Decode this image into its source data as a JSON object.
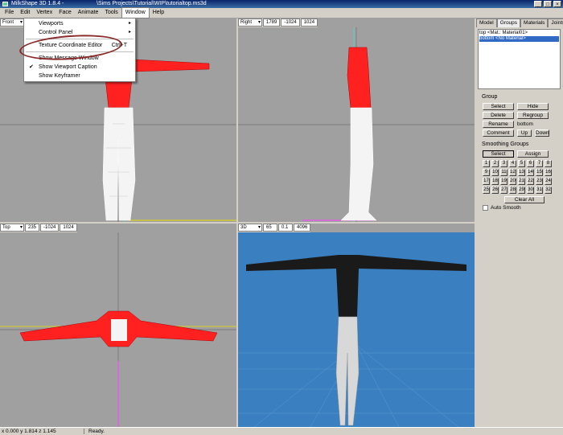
{
  "window": {
    "title": "MilkShape 3D 1.8.4 -",
    "path": "\\Sims Projects\\Tutorial\\WIP\\tutorialtop.ms3d"
  },
  "menu": [
    "File",
    "Edit",
    "Vertex",
    "Face",
    "Animate",
    "Tools",
    "Window",
    "Help"
  ],
  "dropdown": {
    "viewports": "Viewports",
    "control_panel": "Control Panel",
    "texture_editor": "Texture Coordinate Editor",
    "texture_shortcut": "Ctrl+T",
    "message_window": "Show Message Window",
    "viewport_caption": "Show Viewport Caption",
    "keyframer": "Show Keyframer",
    "check": "✔",
    "arrow": "▸"
  },
  "viewports": {
    "front": {
      "mode": "Front"
    },
    "right": {
      "mode": "Right",
      "v1": "1789",
      "v2": "-1024",
      "v3": "1024"
    },
    "top": {
      "mode": "Top",
      "v1": "235",
      "v2": "-1024",
      "v3": "1024"
    },
    "persp": {
      "mode": "3D",
      "v1": "65",
      "v2": "0.1",
      "v3": "4096"
    }
  },
  "panel": {
    "tabs": [
      "Model",
      "Groups",
      "Materials",
      "Joints"
    ],
    "groups": [
      "top <Mat.: Material01>",
      "bottom <No Material>"
    ],
    "group_label": "Group",
    "select": "Select",
    "hide": "Hide",
    "delete": "Delete",
    "regroup": "Regroup",
    "rename": "Rename",
    "rename_value": "bottom",
    "comment": "Comment",
    "up": "Up",
    "down": "Down",
    "smoothing_label": "Smoothing Groups",
    "sg_select": "Select",
    "sg_assign": "Assign",
    "sg_numbers": [
      "1",
      "2",
      "3",
      "4",
      "5",
      "6",
      "7",
      "8",
      "9",
      "10",
      "11",
      "12",
      "13",
      "14",
      "15",
      "16",
      "17",
      "18",
      "19",
      "20",
      "21",
      "22",
      "23",
      "24",
      "25",
      "26",
      "27",
      "28",
      "29",
      "30",
      "31",
      "32"
    ],
    "clear_all": "Clear All",
    "auto_smooth": "Auto Smooth"
  },
  "status": {
    "coords": "x 0.000 y 1.814 z 1.145",
    "text": "Ready."
  },
  "colors": {
    "mesh_red": "#ff0000",
    "mesh_white": "#ffffff",
    "sky": "#3a7fbf",
    "viewport_bg": "#a0a0a0"
  }
}
